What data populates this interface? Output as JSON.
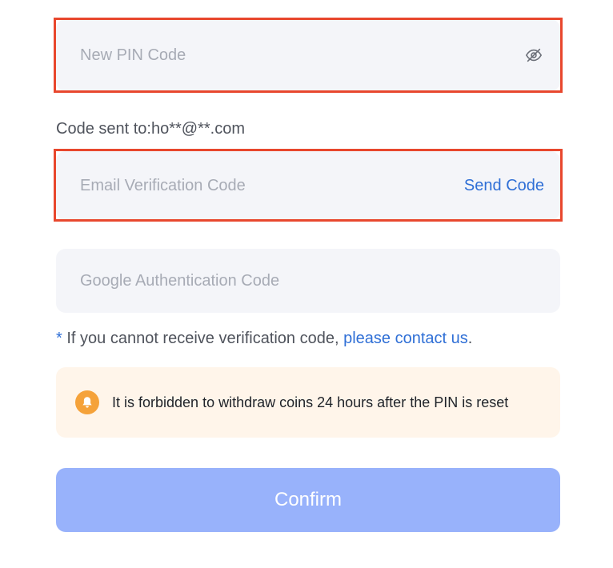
{
  "form": {
    "new_pin": {
      "placeholder": "New PIN Code",
      "value": "",
      "toggle_icon": "eye-off-icon"
    },
    "code_sent_prefix": "Code sent to:",
    "code_sent_email": "ho**@**.com",
    "email_code": {
      "placeholder": "Email Verification Code",
      "value": "",
      "send_label": "Send Code"
    },
    "google_code": {
      "placeholder": "Google Authentication Code",
      "value": ""
    },
    "help": {
      "asterisk": "*",
      "text": " If you cannot receive verification code, ",
      "link": "please contact us",
      "period": "."
    },
    "notice": {
      "icon": "bell-icon",
      "text": "It is forbidden to withdraw coins 24 hours after the PIN is reset"
    },
    "confirm_label": "Confirm"
  },
  "colors": {
    "accent": "#2f6fd6",
    "highlight_border": "#e8472d",
    "confirm_disabled": "#98b2fb",
    "notice_bg": "#fff5ea",
    "notice_icon": "#f5a23a",
    "field_bg": "#f4f5f9"
  }
}
